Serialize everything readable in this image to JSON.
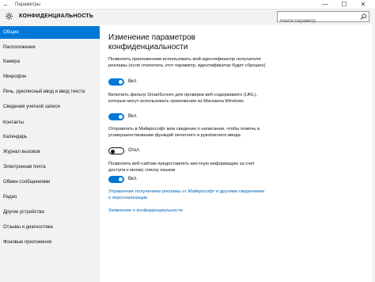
{
  "window": {
    "back": "←",
    "title": "Параметры",
    "minimize": "—",
    "maximize": "☐",
    "close": "✕"
  },
  "header": {
    "heading": "КОНФИДЕНЦИАЛЬНОСТЬ",
    "search_placeholder": "Найти параметр"
  },
  "sidebar": {
    "items": [
      {
        "label": "Общие",
        "active": true
      },
      {
        "label": "Расположение"
      },
      {
        "label": "Камера"
      },
      {
        "label": "Микрофон"
      },
      {
        "label": "Речь, рукописный ввод и ввод текста"
      },
      {
        "label": "Сведения учетной записи"
      },
      {
        "label": "Контакты"
      },
      {
        "label": "Календарь"
      },
      {
        "label": "Журнал вызовов"
      },
      {
        "label": "Электронная почта"
      },
      {
        "label": "Обмен сообщениями"
      },
      {
        "label": "Радио"
      },
      {
        "label": "Другие устройства"
      },
      {
        "label": "Отзывы и диагностика"
      },
      {
        "label": "Фоновые приложения"
      }
    ]
  },
  "main": {
    "title": "Изменение параметров конфиденциальности",
    "settings": [
      {
        "description": "Позволить приложениям использовать мой идентификатор получателя рекламы (если отключить этот параметр, идентификатор будет сброшен)",
        "state": "Вкл.",
        "on": true
      },
      {
        "description": "Включить фильтр SmartScreen для проверки веб-содержимого (URL), которые могут использовать приложения из Магазина Windows",
        "state": "Вкл.",
        "on": true
      },
      {
        "description": "Отправлять в Майкрософт мои сведения о написании, чтобы помочь в усовершенствовании функций печатного и рукописного ввода",
        "state": "Откл.",
        "on": false
      },
      {
        "description": "Позволить веб-сайтам предоставлять местную информацию за счет доступа к моему списку языков",
        "state": "Вкл.",
        "on": true
      }
    ],
    "links": {
      "ads": "Управление получением рекламы от Майкрософт и другими сведениями о персонализации",
      "privacy": "Заявление о конфиденциальности"
    }
  },
  "colors": {
    "accent": "#0078d7",
    "link": "#0063b1",
    "sidebar_bg": "#f2f2f2"
  }
}
